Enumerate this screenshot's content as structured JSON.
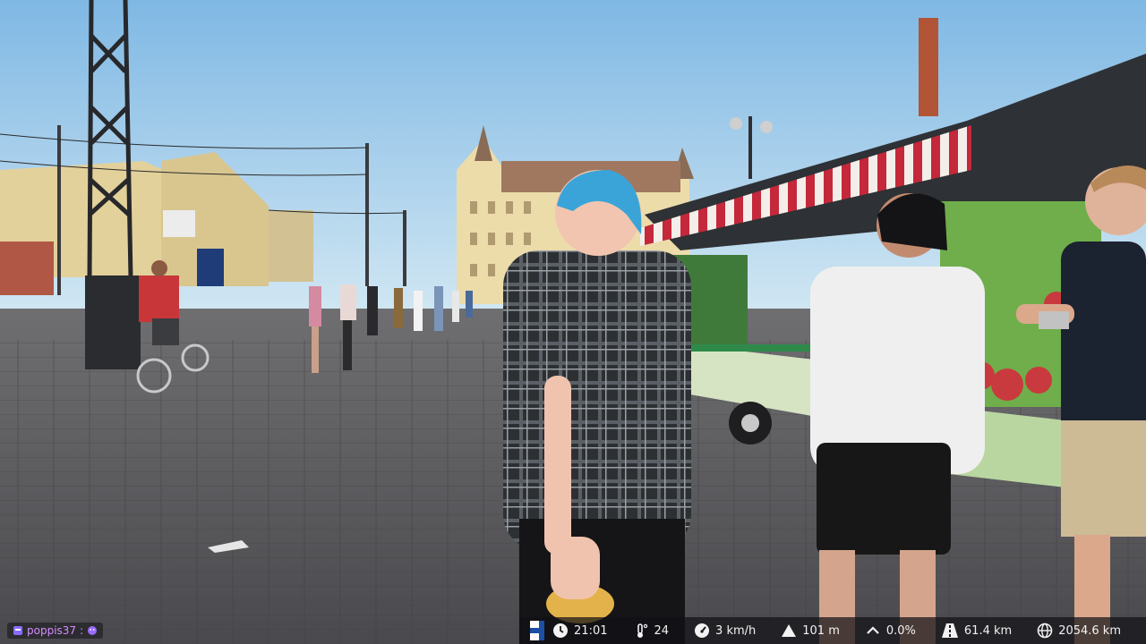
{
  "chat": {
    "user_badge_color": "#8a6bff",
    "username": "poppis37",
    "separator": ":",
    "emote_icon": "purple-emote-icon"
  },
  "hud": {
    "country_flag": "finland-flag-icon",
    "time": {
      "icon": "clock-icon",
      "value": "21:01"
    },
    "temperature": {
      "icon": "thermometer-icon",
      "value": "24"
    },
    "speed": {
      "icon": "speedometer-icon",
      "value": "3 km/h"
    },
    "altitude": {
      "icon": "mountain-icon",
      "value": "101 m"
    },
    "incline": {
      "icon": "chevron-up-icon",
      "value": "0.0%"
    },
    "distance_today": {
      "icon": "road-icon",
      "value": "61.4 km"
    },
    "distance_total": {
      "icon": "globe-icon",
      "value": "2054.6 km"
    }
  },
  "colors": {
    "sky_top": "#8ec4ea",
    "sky_bottom": "#cfe6f4",
    "pavement": "#5b5c60",
    "building_yellow": "#e9d9a6",
    "hair_blue": "#3aa4d8",
    "awning_red": "#c4283a",
    "hud_bg": "#1a1a1e"
  }
}
